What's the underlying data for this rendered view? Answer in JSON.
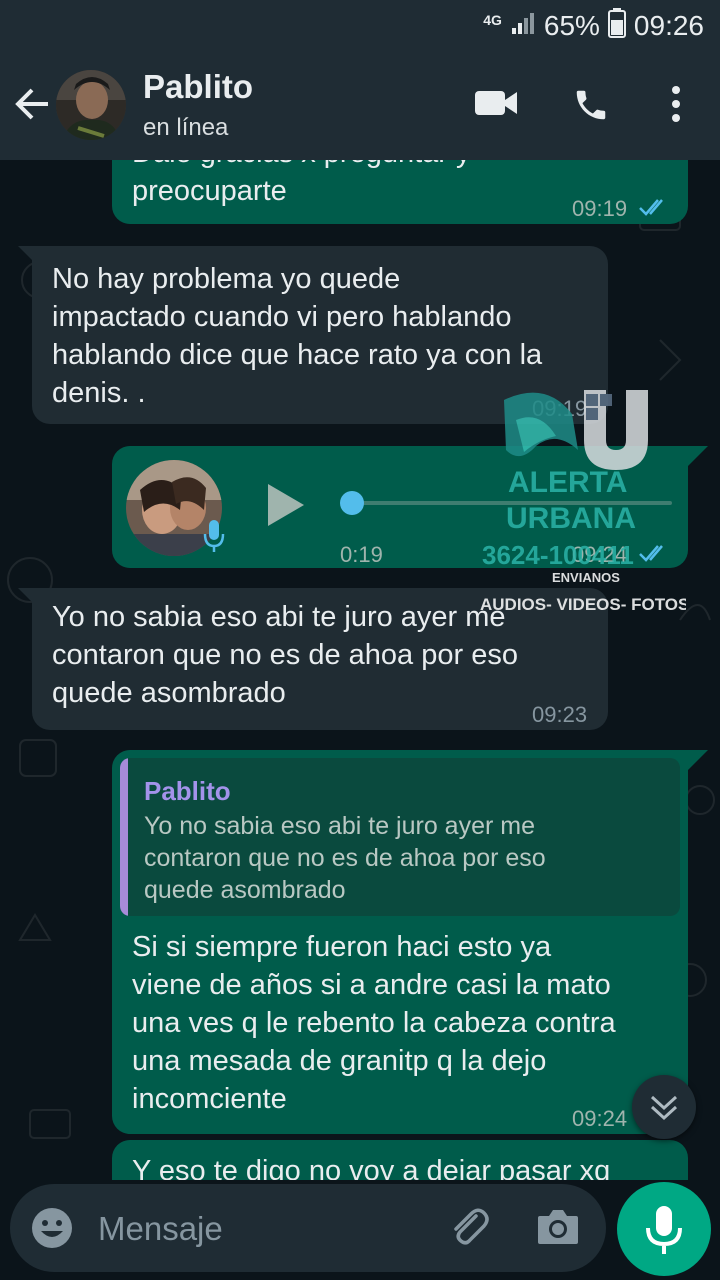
{
  "status_bar": {
    "network": "4G",
    "battery": "65%",
    "time": "09:26"
  },
  "header": {
    "contact_name": "Pablito",
    "status": "en línea",
    "icons": [
      "back-arrow-icon",
      "video-call-icon",
      "phone-icon",
      "more-options-icon"
    ]
  },
  "messages": [
    {
      "direction": "out",
      "text": "Dale gracias x preguntar y\npreocuparte",
      "time": "09:19",
      "read": true
    },
    {
      "direction": "in",
      "text": "No hay problema yo quede\nimpactado cuando vi pero hablando\nhablando dice que hace rato ya con la\ndenis. .",
      "time": "09:19"
    },
    {
      "direction": "out",
      "type": "voice",
      "duration": "0:19",
      "progress": 0,
      "time": "09:24",
      "read": true
    },
    {
      "direction": "in",
      "text": "Yo no sabia eso abi te juro ayer me\ncontaron que no es de ahoa por eso\nquede asombrado",
      "time": "09:23"
    },
    {
      "direction": "out",
      "quote_author": "Pablito",
      "quote_text": "Yo no sabia eso abi te juro ayer me\ncontaron que no es de ahoa por eso\nquede asombrado",
      "text": "Si si siempre fueron haci esto ya\nviene de años si a andre casi la mato\nuna ves q le rebento la cabeza contra\nuna mesada de granitp q la dejo\nincomciente",
      "time": "09:24"
    },
    {
      "direction": "out",
      "text": "Y eso te digo no voy a dejar pasar xq"
    }
  ],
  "watermark": {
    "line1": "ALERTA",
    "line2": "URBANA",
    "phone": "3624-100411",
    "small": "ENVIANOS",
    "bottom": "AUDIOS- VIDEOS- FOTOS"
  },
  "composer": {
    "placeholder": "Mensaje"
  },
  "colors": {
    "outgoing_bubble": "#005c4b",
    "incoming_bubble": "#202c33",
    "accent": "#00a884",
    "read_ticks": "#53bdeb"
  }
}
